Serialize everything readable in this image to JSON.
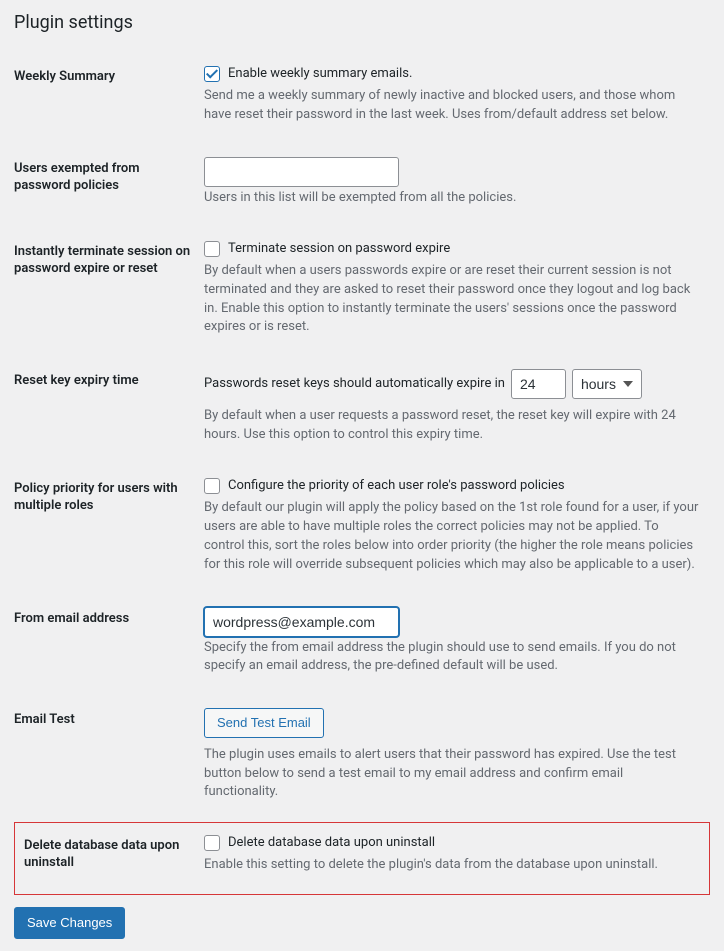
{
  "page": {
    "title": "Plugin settings"
  },
  "weekly_summary": {
    "label": "Weekly Summary",
    "checkbox_label": "Enable weekly summary emails.",
    "checked": true,
    "description": "Send me a weekly summary of newly inactive and blocked users, and those whom have reset their password in the last week. Uses from/default address set below."
  },
  "exempted_users": {
    "label": "Users exempted from password policies",
    "value": "",
    "description": "Users in this list will be exempted from all the policies."
  },
  "terminate_session": {
    "label": "Instantly terminate session on password expire or reset",
    "checkbox_label": "Terminate session on password expire",
    "checked": false,
    "description": "By default when a users passwords expire or are reset their current session is not terminated and they are asked to reset their password once they logout and log back in. Enable this option to instantly terminate the users' sessions once the password expires or is reset."
  },
  "reset_key": {
    "label": "Reset key expiry time",
    "prefix_text": "Passwords reset keys should automatically expire in",
    "value": "24",
    "unit": "hours",
    "description": "By default when a user requests a password reset, the reset key will expire with 24 hours. Use this option to control this expiry time."
  },
  "policy_priority": {
    "label": "Policy priority for users with multiple roles",
    "checkbox_label": "Configure the priority of each user role's password policies",
    "checked": false,
    "description": "By default our plugin will apply the policy based on the 1st role found for a user, if your users are able to have multiple roles the correct policies may not be applied. To control this, sort the roles below into order priority (the higher the role means policies for this role will override subsequent policies which may also be applicable to a user)."
  },
  "from_email": {
    "label": "From email address",
    "value": "wordpress@example.com",
    "description": "Specify the from email address the plugin should use to send emails. If you do not specify an email address, the pre-defined default will be used."
  },
  "email_test": {
    "label": "Email Test",
    "button_label": "Send Test Email",
    "description": "The plugin uses emails to alert users that their password has expired. Use the test button below to send a test email to my email address and confirm email functionality."
  },
  "delete_data": {
    "label": "Delete database data upon uninstall",
    "checkbox_label": "Delete database data upon uninstall",
    "checked": false,
    "description": "Enable this setting to delete the plugin's data from the database upon uninstall."
  },
  "submit": {
    "label": "Save Changes"
  }
}
